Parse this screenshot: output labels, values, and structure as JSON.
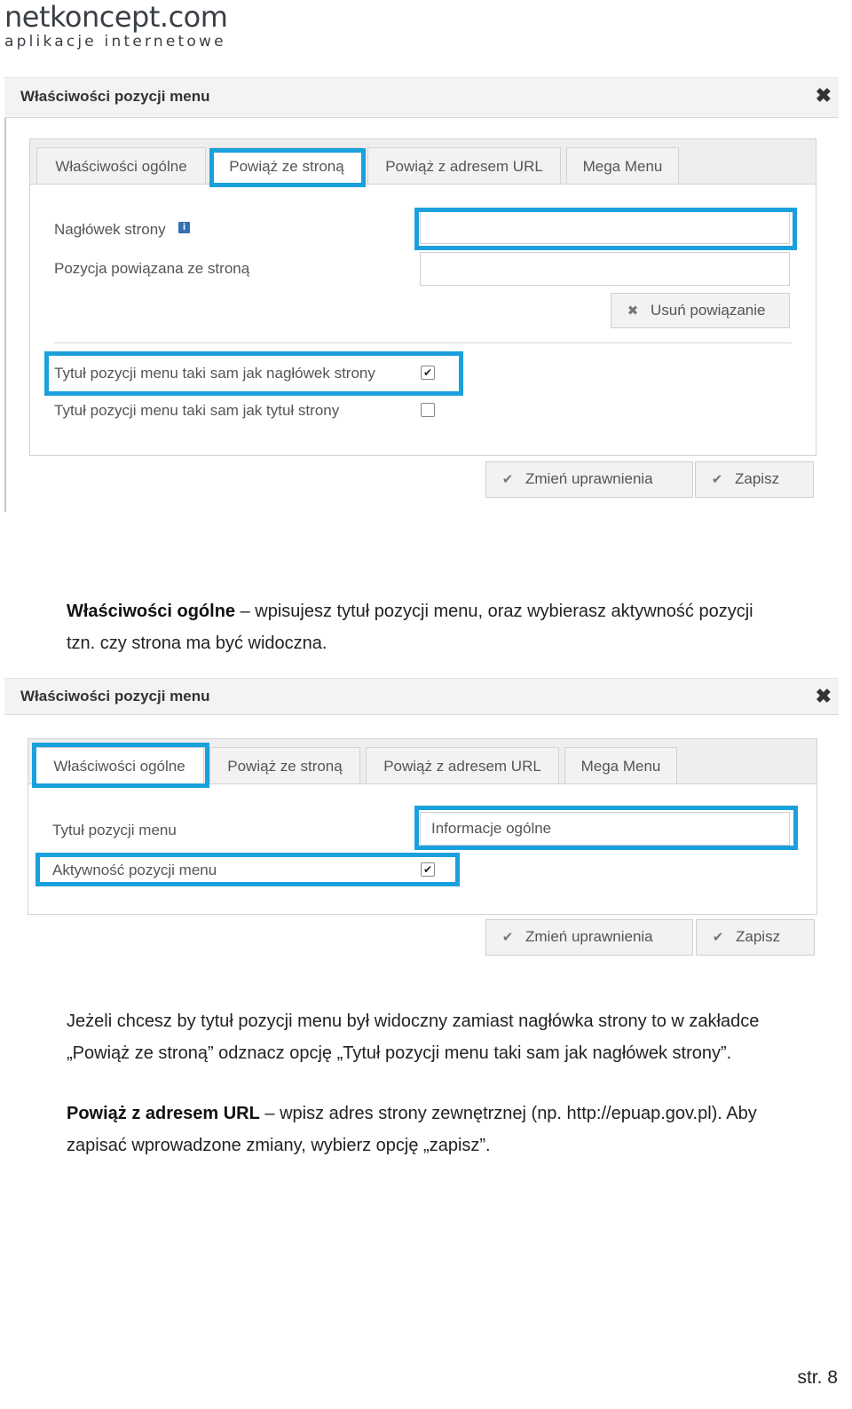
{
  "logo": {
    "main": "netkoncept.com",
    "sub": "aplikacje internetowe"
  },
  "dialog1": {
    "title": "Właściwości pozycji menu",
    "close": "✖",
    "tabs": [
      "Właściwości ogólne",
      "Powiąż ze stroną",
      "Powiąż z adresem URL",
      "Mega Menu"
    ],
    "active_tab": "Powiąż ze stroną",
    "labels": {
      "header": "Nagłówek strony",
      "linked": "Pozycja powiązana ze stroną"
    },
    "info_icon": "info-icon",
    "remove_button": "Usuń powiązanie",
    "check1": {
      "label": "Tytuł pozycji menu taki sam jak nagłówek strony",
      "checked": true
    },
    "check2": {
      "label": "Tytuł pozycji menu taki sam jak tytuł strony",
      "checked": false
    },
    "btn_permissions": "Zmień uprawnienia",
    "btn_save": "Zapisz"
  },
  "para1": {
    "bold": "Właściwości ogólne",
    "rest": " – wpisujesz tytuł pozycji menu, oraz wybierasz aktywność pozycji",
    "line2": "tzn. czy strona ma być widoczna."
  },
  "dialog2": {
    "title": "Właściwości pozycji menu",
    "close": "✖",
    "tabs": [
      "Właściwości ogólne",
      "Powiąż ze stroną",
      "Powiąż z adresem URL",
      "Mega Menu"
    ],
    "active_tab": "Właściwości ogólne",
    "labels": {
      "title": "Tytuł pozycji menu",
      "active": "Aktywność pozycji menu"
    },
    "title_value": "Informacje ogólne",
    "active_checked": true,
    "btn_permissions": "Zmień uprawnienia",
    "btn_save": "Zapisz"
  },
  "para2": {
    "line1": "Jeżeli chcesz by tytuł pozycji menu był widoczny zamiast nagłówka strony to w zakładce",
    "line2": "„Powiąż ze stroną” odznacz opcję „Tytuł pozycji menu taki sam jak nagłówek strony”."
  },
  "para3": {
    "bold": "Powiąż z adresem URL",
    "rest": " – wpisz adres strony zewnętrznej (np. http://epuap.gov.pl). Aby",
    "line2": "zapisać wprowadzone zmiany, wybierz opcję „zapisz”."
  },
  "footer": {
    "page": "str. 8"
  },
  "colors": {
    "highlight": "#1aa0dc",
    "info": "#3570b5"
  }
}
